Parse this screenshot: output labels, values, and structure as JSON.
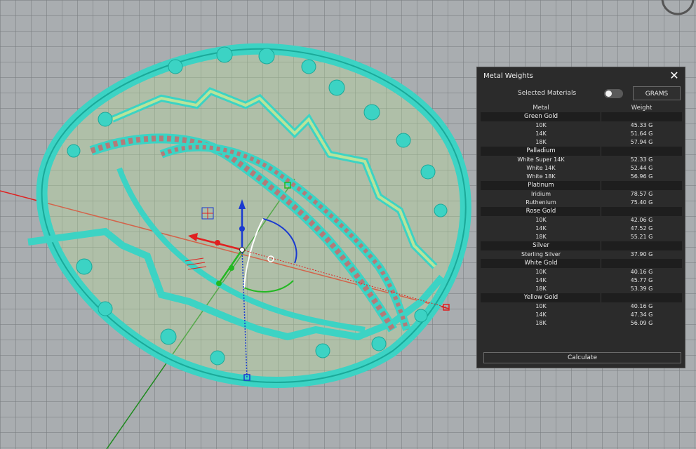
{
  "panel": {
    "title": "Metal Weights",
    "selected_materials_label": "Selected Materials",
    "selected_materials_on": false,
    "units_label": "GRAMS",
    "columns": {
      "metal": "Metal",
      "weight": "Weight"
    },
    "groups": [
      {
        "name": "Green Gold",
        "items": [
          {
            "metal": "10K",
            "weight": "45.33 G"
          },
          {
            "metal": "14K",
            "weight": "51.64 G"
          },
          {
            "metal": "18K",
            "weight": "57.94 G"
          }
        ]
      },
      {
        "name": "Palladium",
        "items": [
          {
            "metal": "White Super 14K",
            "weight": "52.33 G"
          },
          {
            "metal": "White 14K",
            "weight": "52.44 G"
          },
          {
            "metal": "White 18K",
            "weight": "56.96 G"
          }
        ]
      },
      {
        "name": "Platinum",
        "items": [
          {
            "metal": "Iridium",
            "weight": "78.57 G"
          },
          {
            "metal": "Ruthenium",
            "weight": "75.40 G"
          }
        ]
      },
      {
        "name": "Rose Gold",
        "items": [
          {
            "metal": "10K",
            "weight": "42.06 G"
          },
          {
            "metal": "14K",
            "weight": "47.52 G"
          },
          {
            "metal": "18K",
            "weight": "55.21 G"
          }
        ]
      },
      {
        "name": "Silver",
        "items": [
          {
            "metal": "Sterling Silver",
            "weight": "37.90 G"
          }
        ]
      },
      {
        "name": "White Gold",
        "items": [
          {
            "metal": "10K",
            "weight": "40.16 G"
          },
          {
            "metal": "14K",
            "weight": "45.77 G"
          },
          {
            "metal": "18K",
            "weight": "53.39 G"
          }
        ]
      },
      {
        "name": "Yellow Gold",
        "items": [
          {
            "metal": "10K",
            "weight": "40.16 G"
          },
          {
            "metal": "14K",
            "weight": "47.34 G"
          },
          {
            "metal": "18K",
            "weight": "56.09 G"
          }
        ]
      }
    ],
    "calculate_label": "Calculate"
  },
  "viewport": {
    "icons": [
      "gumball-widget-icon",
      "view-navigator-icon"
    ],
    "colors": {
      "background": "#a9adb0",
      "model": "#3cd3c4",
      "model_fill": "#b9e39a",
      "gem": "#b47a78",
      "x_axis": "#e02020",
      "y_axis": "#1e8a1e",
      "z_axis": "#1a3ad0"
    }
  }
}
